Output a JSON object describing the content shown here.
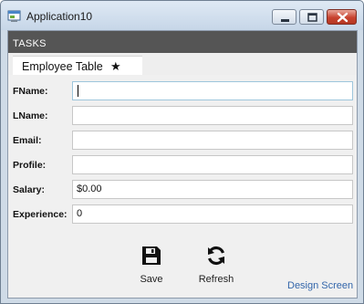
{
  "window": {
    "title": "Application10"
  },
  "tasks_bar": {
    "label": "TASKS"
  },
  "tab": {
    "label": "Employee Table",
    "modified_marker": "★"
  },
  "form": {
    "fields": [
      {
        "label": "FName:",
        "value": ""
      },
      {
        "label": "LName:",
        "value": ""
      },
      {
        "label": "Email:",
        "value": ""
      },
      {
        "label": "Profile:",
        "value": ""
      },
      {
        "label": "Salary:",
        "value": "$0.00"
      },
      {
        "label": "Experience:",
        "value": "0"
      }
    ]
  },
  "commands": {
    "save_label": "Save",
    "refresh_label": "Refresh",
    "design_screen_label": "Design Screen"
  },
  "icons": {
    "app": "application-icon",
    "save": "floppy-disk-icon",
    "refresh": "refresh-icon"
  },
  "colors": {
    "tasks_bar": "#555555",
    "link": "#3366aa",
    "close_button": "#c8432f"
  }
}
